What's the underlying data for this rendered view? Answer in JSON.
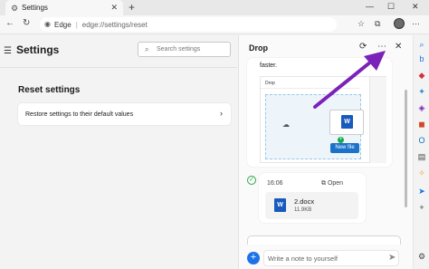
{
  "tab": {
    "title": "Settings",
    "icon": "gear-icon",
    "close": "✕"
  },
  "browser": {
    "new_tab": "+",
    "min": "—",
    "max": "☐",
    "close": "✕",
    "address_label": "Edge",
    "address_sep": "|",
    "address_url": "edge://settings/reset"
  },
  "settings": {
    "title": "Settings",
    "search_placeholder": "Search settings",
    "section_title": "Reset settings",
    "reset_item": "Restore settings to their default values"
  },
  "drop": {
    "title": "Drop",
    "message_text": "faster.",
    "shot_title": "Drop",
    "new_file_label": "New file",
    "file_time": "16:06",
    "file_open": "Open",
    "file_name": "2.docx",
    "file_size": "11.9KB",
    "note_placeholder": "Write a note to yourself"
  },
  "colors": {
    "accent": "#1a73e8",
    "arrow": "#7b22b8",
    "word": "#185abd",
    "green": "#2aa84a"
  }
}
